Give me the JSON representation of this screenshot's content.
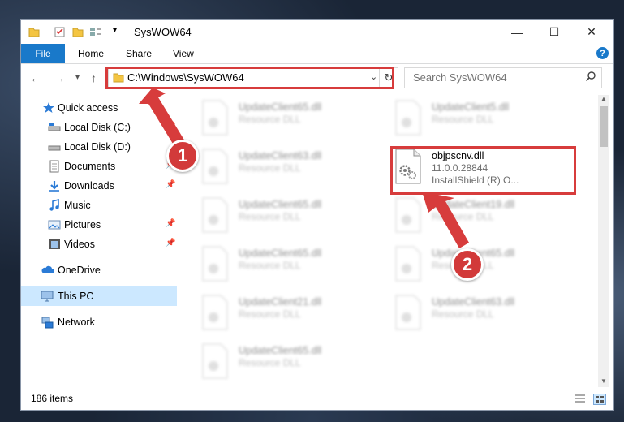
{
  "window": {
    "title": "SysWOW64",
    "controls": {
      "minimize": "—",
      "maximize": "☐",
      "close": "✕"
    }
  },
  "ribbon": {
    "file_tab": "File",
    "tabs": [
      "Home",
      "Share",
      "View"
    ],
    "help": "?"
  },
  "nav": {
    "address": "C:\\Windows\\SysWOW64",
    "search_placeholder": "Search SysWOW64"
  },
  "sidebar": {
    "items": [
      {
        "label": "Quick access",
        "icon": "star-icon"
      },
      {
        "label": "Local Disk (C:)",
        "icon": "drive-icon"
      },
      {
        "label": "Local Disk (D:)",
        "icon": "drive-icon"
      },
      {
        "label": "Documents",
        "icon": "document-icon"
      },
      {
        "label": "Downloads",
        "icon": "download-icon"
      },
      {
        "label": "Music",
        "icon": "music-icon"
      },
      {
        "label": "Pictures",
        "icon": "picture-icon"
      },
      {
        "label": "Videos",
        "icon": "video-icon"
      },
      {
        "label": "OneDrive",
        "icon": "cloud-icon"
      },
      {
        "label": "This PC",
        "icon": "computer-icon"
      },
      {
        "label": "Network",
        "icon": "network-icon"
      }
    ]
  },
  "files": {
    "left": [
      {
        "name": "UpdateClient65.dll",
        "desc": "Resource DLL"
      },
      {
        "name": "UpdateClient63.dll",
        "desc": "Resource DLL"
      },
      {
        "name": "UpdateClient65.dll",
        "desc": "Resource DLL"
      },
      {
        "name": "UpdateClient65.dll",
        "desc": "Resource DLL"
      },
      {
        "name": "UpdateClient21.dll",
        "desc": "Resource DLL"
      },
      {
        "name": "UpdateClient65.dll",
        "desc": "Resource DLL"
      }
    ],
    "right": [
      {
        "name": "UpdateClient5.dll",
        "desc": "Resource DLL"
      },
      {
        "name": "UpdateClient19.dll",
        "desc": "Resource DLL"
      },
      {
        "name": "UpdateClient65.dll",
        "desc": "Resource DLL"
      },
      {
        "name": "UpdateClient63.dll",
        "desc": "Resource DLL"
      }
    ],
    "highlighted": {
      "name": "objpscnv.dll",
      "version": "11.0.0.28844",
      "desc": "InstallShield (R) O..."
    }
  },
  "status": {
    "count": "186 items"
  },
  "annotations": {
    "step1": "1",
    "step2": "2",
    "color": "#d73c3c"
  }
}
